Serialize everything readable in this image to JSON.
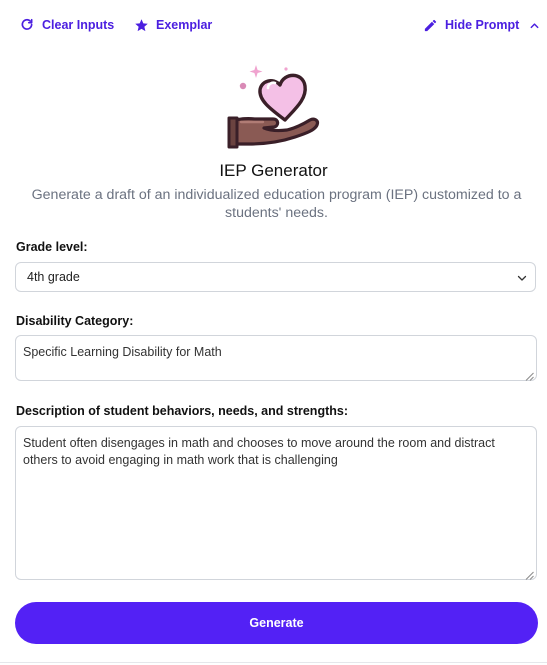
{
  "toolbar": {
    "clear_label": "Clear Inputs",
    "exemplar_label": "Exemplar",
    "hide_prompt_label": "Hide Prompt"
  },
  "tool": {
    "title": "IEP Generator",
    "description": "Generate a draft of an individualized education program (IEP) customized to a students' needs."
  },
  "form": {
    "grade_label": "Grade level:",
    "grade_value": "4th grade",
    "disability_label": "Disability Category:",
    "disability_value": "Specific Learning Disability for Math",
    "description_label": "Description of student behaviors, needs, and strengths:",
    "description_value": "Student often disengages in math and chooses to move around the room and distract others to avoid engaging in math work that is challenging",
    "generate_label": "Generate"
  },
  "colors": {
    "accent": "#4b1fe0",
    "button": "#5321f5",
    "subtitle": "#6b7280"
  },
  "icons": {
    "clear": "refresh-icon",
    "exemplar": "star-icon",
    "hide_prompt": "pencil-icon",
    "collapse": "chevron-up-icon",
    "select": "chevron-down-icon",
    "hero": "heart-hand-icon"
  }
}
